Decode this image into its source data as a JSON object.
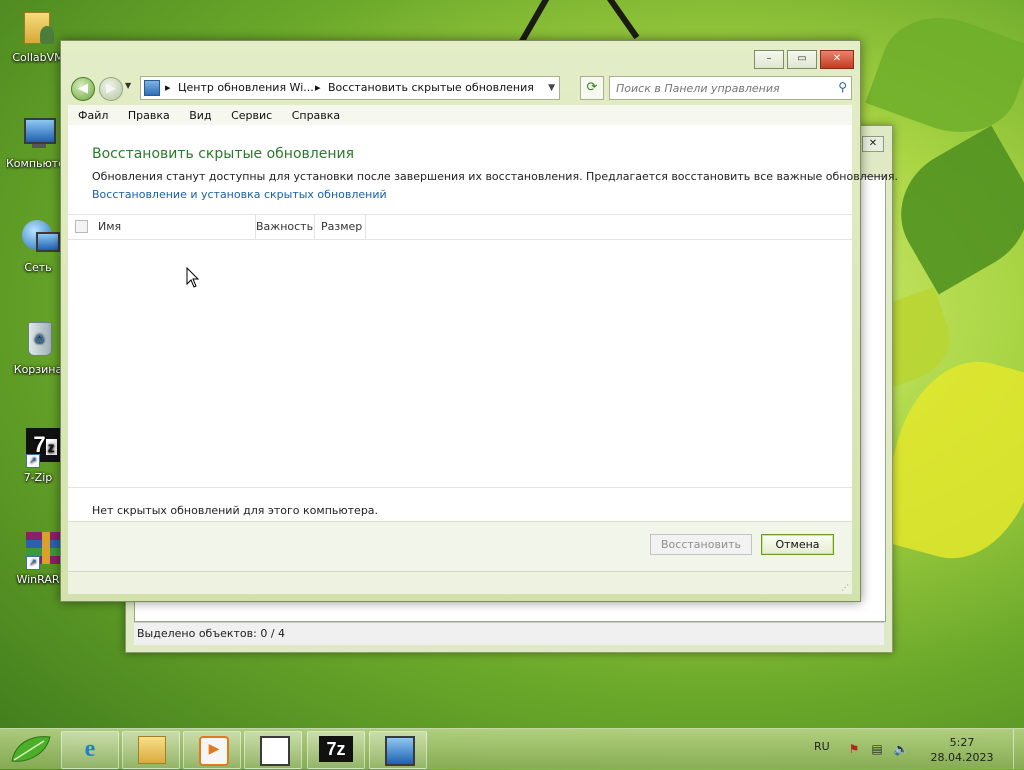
{
  "desktop": {
    "icons": [
      {
        "label": "CollabVM"
      },
      {
        "label": "Компьютер"
      },
      {
        "label": "Сеть"
      },
      {
        "label": "Корзина"
      },
      {
        "label": "7-Zip"
      },
      {
        "label": "WinRAR"
      }
    ]
  },
  "background_window": {
    "close_glyph": "✕",
    "status_text": "Выделено объектов: 0 / 4"
  },
  "window": {
    "controls": {
      "minimize": "–",
      "maximize": "▭",
      "close": "✕"
    },
    "address": {
      "segments": [
        "Центр обновления Wi...",
        "Восстановить скрытые обновления"
      ],
      "separator": "▸"
    },
    "search": {
      "placeholder": "Поиск в Панели управления"
    },
    "menu": [
      "Файл",
      "Правка",
      "Вид",
      "Сервис",
      "Справка"
    ],
    "heading": "Восстановить скрытые обновления",
    "description": "Обновления станут доступны для установки после завершения их восстановления. Предлагается восстановить все важные обновления.",
    "link": "Восстановление и установка скрытых обновлений",
    "columns": [
      "Имя",
      "Важность",
      "Размер"
    ],
    "empty_message": "Нет скрытых обновлений для этого компьютера.",
    "buttons": {
      "restore": "Восстановить",
      "cancel": "Отмена"
    }
  },
  "taskbar": {
    "apps": [
      "internet-explorer",
      "file-explorer",
      "media-player",
      "control-panel",
      "7-zip",
      "remote-desktop"
    ],
    "language": "RU",
    "time": "5:27",
    "date": "28.04.2023"
  },
  "colors": {
    "heading_green": "#2b7a2b",
    "link_blue": "#1b5fa8",
    "close_red": "#c43b20"
  }
}
